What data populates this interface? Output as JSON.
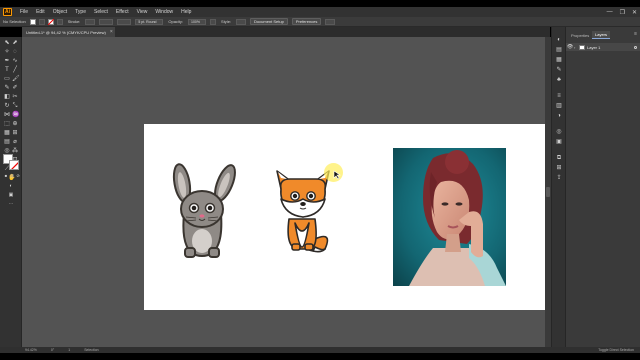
{
  "app": {
    "logo": "Ai"
  },
  "menubar": {
    "items": [
      "File",
      "Edit",
      "Object",
      "Type",
      "Select",
      "Effect",
      "View",
      "Window",
      "Help"
    ]
  },
  "window_controls": {
    "minimize": "—",
    "maximize": "❐",
    "close": "✕"
  },
  "controlbar": {
    "selection_label": "No Selection",
    "stroke_label": "Stroke:",
    "stroke_value": "",
    "brush_value": "5 pt. Round",
    "opacity_label": "Opacity:",
    "opacity_value": "100%",
    "style_label": "Style:",
    "document_setup_label": "Document Setup",
    "preferences_label": "Preferences"
  },
  "document_tab": {
    "title": "Untitled-1* @ 94,42 % (CMYK/CPU Preview)",
    "close": "×"
  },
  "panel": {
    "tabs": [
      "Properties",
      "Layers"
    ],
    "active_tab": "Layers",
    "menu_icon": "≡",
    "layers": [
      {
        "name": "Layer 1",
        "visible": true
      }
    ]
  },
  "statusbar": {
    "zoom": "94.42%",
    "rotation": "0°",
    "artboard_nav": "1",
    "tool": "Selection",
    "right_text": "Toggle Direct Selection"
  },
  "colors": {
    "accent": "#ff9a00",
    "canvas": "#535353",
    "artboard": "#ffffff",
    "ui_dark": "#323232",
    "layer_highlight": "#8aa8d8"
  }
}
